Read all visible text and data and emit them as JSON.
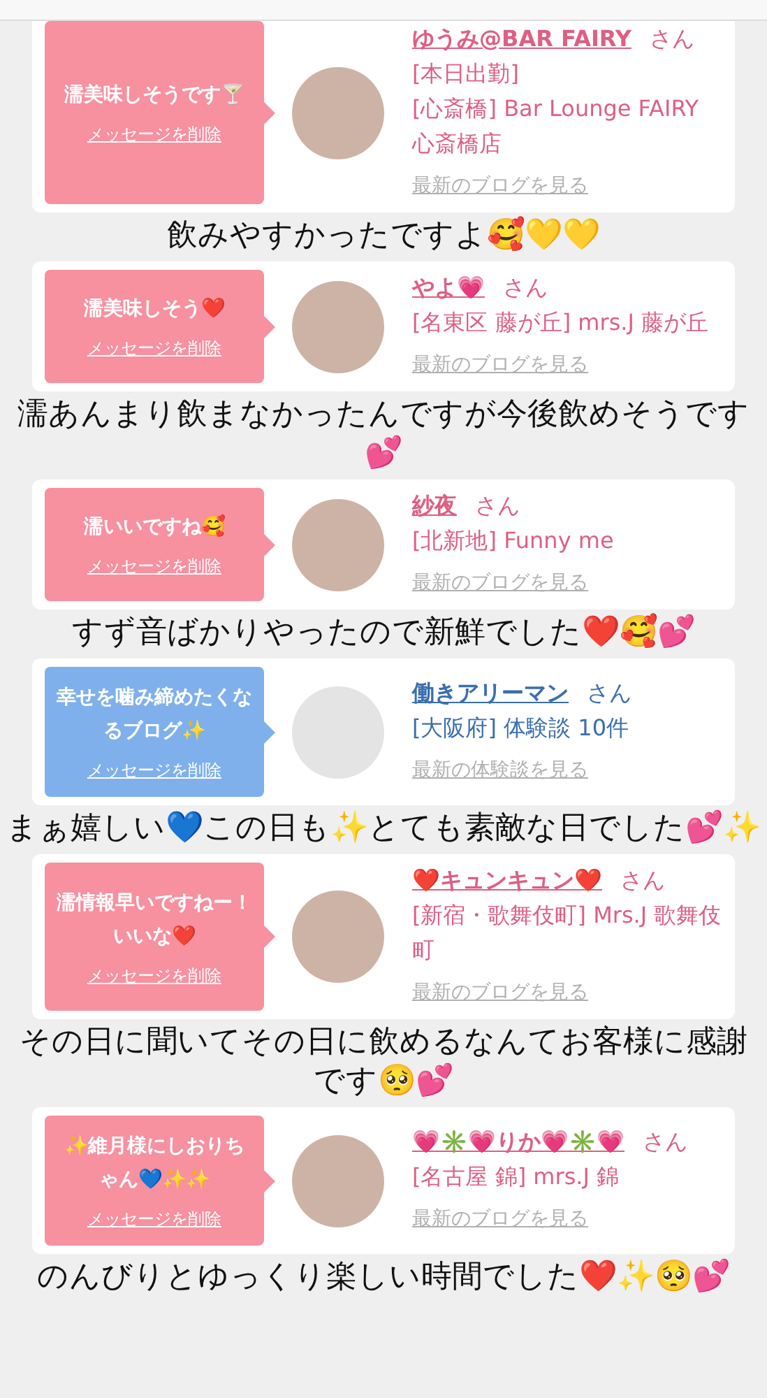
{
  "cards": [
    {
      "kind": "cast",
      "message": "濡美味しそうです🍸",
      "delete_link": "メッセージを削除",
      "name": "ゆうみ@BAR FAIRY",
      "honorific": "さん",
      "tag": "[本日出勤]",
      "location": "[心斎橋] Bar Lounge FAIRY 心斎橋店",
      "more_link": "最新のブログを見る"
    },
    {
      "kind": "cast",
      "message": "濡美味しそう❤️",
      "delete_link": "メッセージを削除",
      "name": "やよ💗",
      "honorific": "さん",
      "location": "[名東区 藤が丘] mrs.J 藤が丘",
      "more_link": "最新のブログを見る"
    },
    {
      "kind": "cast",
      "message": "濡いいですね🥰",
      "delete_link": "メッセージを削除",
      "name": "紗夜",
      "honorific": "さん",
      "location": "[北新地] Funny me",
      "more_link": "最新のブログを見る"
    },
    {
      "kind": "reviewer",
      "message": "幸せを噛み締めたくなるブログ✨",
      "delete_link": "メッセージを削除",
      "name": "働きアリーマン",
      "honorific": "さん",
      "location": "[大阪府] 体験談 10件",
      "more_link": "最新の体験談を見る"
    },
    {
      "kind": "cast",
      "message": "濡情報早いですねー！いいな❤️",
      "delete_link": "メッセージを削除",
      "name": "❤️キュンキュン❤️",
      "honorific": "さん",
      "location": "[新宿・歌舞伎町] Mrs.J 歌舞伎町",
      "more_link": "最新のブログを見る"
    },
    {
      "kind": "cast",
      "message": "✨維月様にしおりちゃん💙✨✨",
      "delete_link": "メッセージを削除",
      "name": "💗✳️💗りか💗✳️💗",
      "honorific": "さん",
      "location": "[名古屋 錦] mrs.J 錦",
      "more_link": "最新のブログを見る"
    }
  ],
  "captions": [
    {
      "text": "飲みやすかったですよ🥰💛💛"
    },
    {
      "text": "濡あんまり飲まなかったんですが今後飲めそうです💕"
    },
    {
      "text": "すず音ばかりやったので新鮮でした❤️🥰💕"
    },
    {
      "text": "まぁ嬉しい💙この日も✨とても素敵な日でした💕✨"
    },
    {
      "text": "その日に聞いてその日に飲めるなんてお客様に感謝です🥺💕"
    },
    {
      "text": "のんびりとゆっくり楽しい時間でした❤️✨🥺💕"
    }
  ]
}
